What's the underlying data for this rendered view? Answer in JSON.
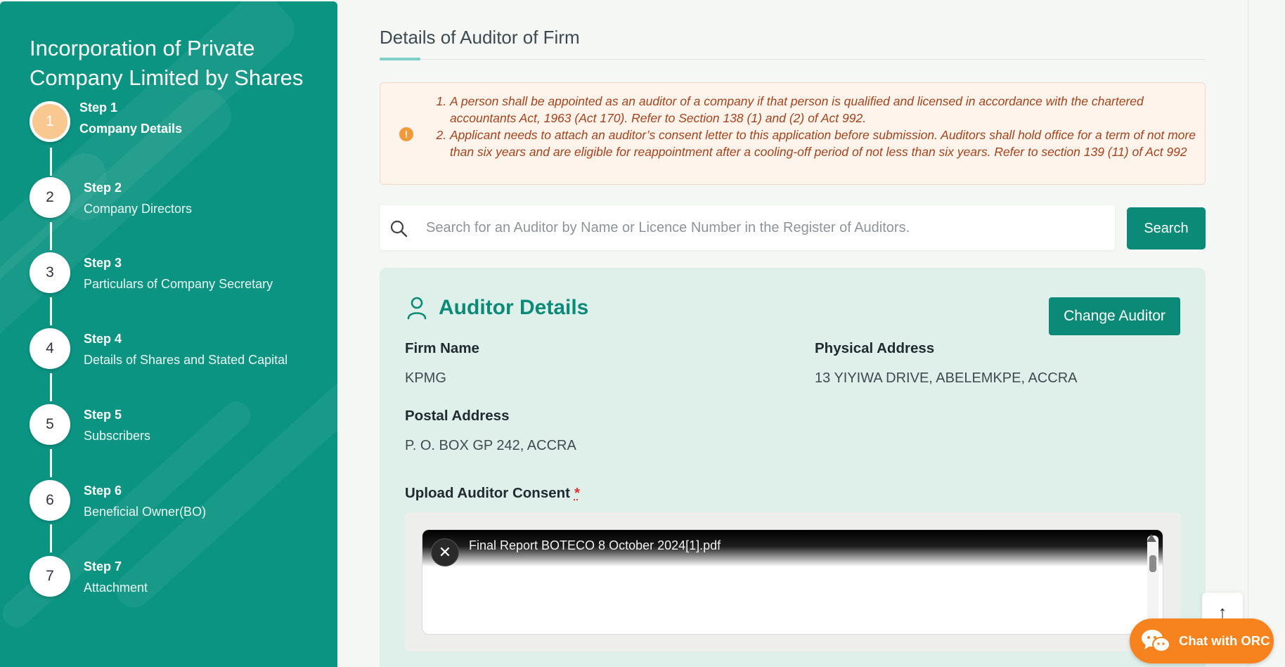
{
  "sidebar": {
    "title": "Incorporation of Private Company Limited by Shares",
    "steps": [
      {
        "number": "1",
        "label": "Step 1",
        "desc": "Company Details"
      },
      {
        "number": "2",
        "label": "Step 2",
        "desc": "Company Directors"
      },
      {
        "number": "3",
        "label": "Step 3",
        "desc": "Particulars of Company Secretary"
      },
      {
        "number": "4",
        "label": "Step 4",
        "desc": "Details of Shares and Stated Capital"
      },
      {
        "number": "5",
        "label": "Step 5",
        "desc": "Subscribers"
      },
      {
        "number": "6",
        "label": "Step 6",
        "desc": "Beneficial Owner(BO)"
      },
      {
        "number": "7",
        "label": "Step 7",
        "desc": "Attachment"
      }
    ]
  },
  "main": {
    "title": "Details of Auditor of Firm",
    "notice": {
      "icon": "exclamation-icon",
      "items": [
        "A person shall be appointed as an auditor of a company if that person is qualified and licensed in accordance with the chartered accountants Act, 1963 (Act 170). Refer to Section 138 (1) and (2) of Act 992.",
        "Applicant needs to attach an auditor’s consent letter to this application before submission. Auditors shall hold office for a term of not more than six years and are eligible for reappointment after a cooling-off period of not less than six years. Refer to section 139 (11) of Act 992"
      ]
    },
    "search": {
      "placeholder": "Search for an Auditor by Name or Licence Number in the Register of Auditors.",
      "value": "",
      "button_label": "Search"
    },
    "auditor": {
      "title": "Auditor Details",
      "change_button": "Change Auditor",
      "firm_name_label": "Firm Name",
      "firm_name": "KPMG",
      "physical_address_label": "Physical Address",
      "physical_address": "13 YIYIWA DRIVE, ABELEMKPE, ACCRA",
      "postal_address_label": "Postal Address",
      "postal_address": "P. O. BOX GP 242, ACCRA",
      "upload_label": "Upload Auditor Consent",
      "required_mark": "*",
      "file_name": "Final Report BOTECO 8 October 2024[1].pdf",
      "remove_symbol": "✕"
    }
  },
  "floating": {
    "scroll_top_symbol": "↑",
    "chat_label": "Chat with ORC"
  },
  "colors": {
    "primary": "#0b8a78",
    "sidebar": "#0b9482",
    "accent_orange": "#f7831f",
    "active_step": "#f8c890",
    "notice_text": "#a6421a"
  }
}
